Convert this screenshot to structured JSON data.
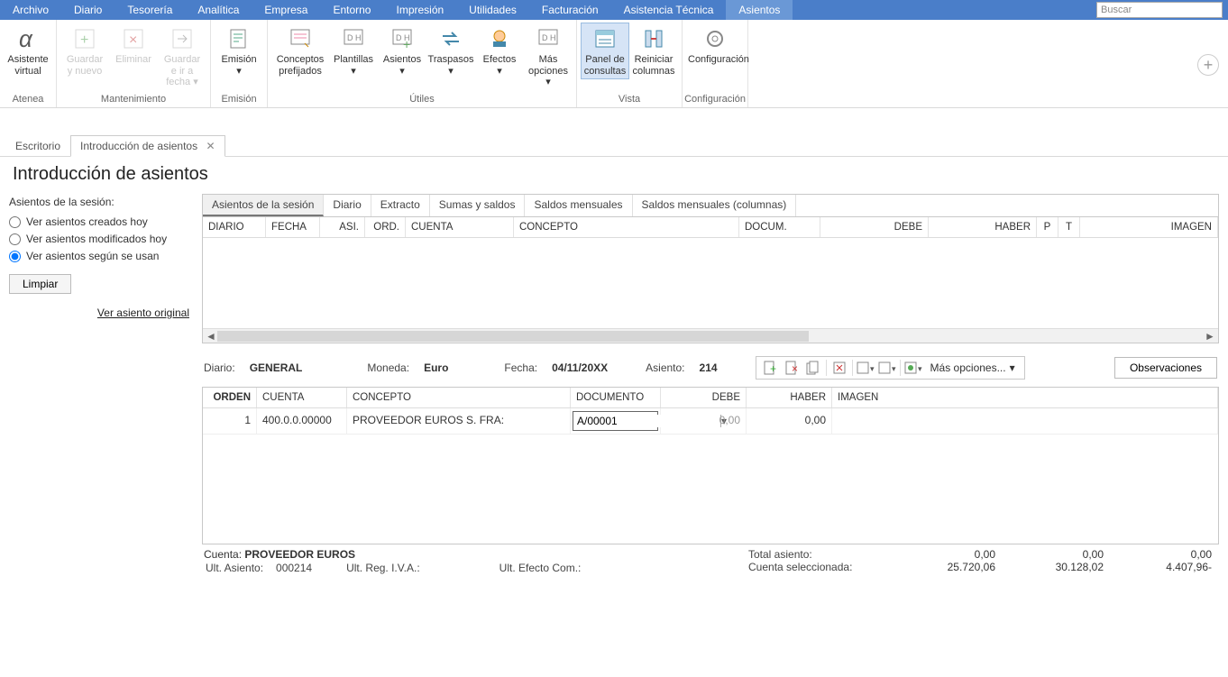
{
  "menubar": {
    "items": [
      "Archivo",
      "Diario",
      "Tesorería",
      "Analítica",
      "Empresa",
      "Entorno",
      "Impresión",
      "Utilidades",
      "Facturación",
      "Asistencia Técnica",
      "Asientos"
    ],
    "active_index": 10,
    "search_placeholder": "Buscar"
  },
  "ribbon": {
    "groups": [
      {
        "label": "Atenea",
        "buttons": [
          {
            "label": "Asistente virtual",
            "icon": "alpha"
          }
        ]
      },
      {
        "label": "Mantenimiento",
        "buttons": [
          {
            "label": "Guardar y nuevo",
            "icon": "save-new",
            "disabled": true
          },
          {
            "label": "Eliminar",
            "icon": "delete",
            "disabled": true
          },
          {
            "label": "Guardar e ir a fecha",
            "icon": "save-goto",
            "disabled": true,
            "dropdown": true
          }
        ]
      },
      {
        "label": "Emisión",
        "buttons": [
          {
            "label": "Emisión",
            "icon": "emit",
            "dropdown": true
          }
        ]
      },
      {
        "label": "Útiles",
        "buttons": [
          {
            "label": "Conceptos prefijados",
            "icon": "concepts"
          },
          {
            "label": "Plantillas",
            "icon": "templates",
            "dropdown": true
          },
          {
            "label": "Asientos",
            "icon": "asientos",
            "dropdown": true
          },
          {
            "label": "Traspasos",
            "icon": "transfers",
            "dropdown": true
          },
          {
            "label": "Efectos",
            "icon": "effects",
            "dropdown": true
          },
          {
            "label": "Más opciones",
            "icon": "more",
            "dropdown": true
          }
        ]
      },
      {
        "label": "Vista",
        "buttons": [
          {
            "label": "Panel de consultas",
            "icon": "panel",
            "active": true
          },
          {
            "label": "Reiniciar columnas",
            "icon": "reset-cols"
          }
        ]
      },
      {
        "label": "Configuración",
        "buttons": [
          {
            "label": "Configuración",
            "icon": "gear"
          }
        ]
      }
    ]
  },
  "workspace_tabs": {
    "items": [
      {
        "label": "Escritorio",
        "closable": false
      },
      {
        "label": "Introducción de asientos",
        "closable": true
      }
    ],
    "active_index": 1
  },
  "page_title": "Introducción de asientos",
  "left_panel": {
    "section": "Asientos de la sesión:",
    "radios": [
      {
        "label": "Ver asientos creados hoy",
        "checked": false
      },
      {
        "label": "Ver asientos modificados hoy",
        "checked": false
      },
      {
        "label": "Ver asientos según se usan",
        "checked": true
      }
    ],
    "clear_btn": "Limpiar",
    "link": "Ver asiento original"
  },
  "consult": {
    "tabs": [
      "Asientos de la sesión",
      "Diario",
      "Extracto",
      "Sumas y saldos",
      "Saldos mensuales",
      "Saldos mensuales (columnas)"
    ],
    "active_tab": 0,
    "columns": [
      "DIARIO",
      "FECHA",
      "ASI.",
      "ORD.",
      "CUENTA",
      "CONCEPTO",
      "DOCUM.",
      "DEBE",
      "HABER",
      "P",
      "T",
      "IMAGEN"
    ]
  },
  "meta": {
    "diario_lbl": "Diario:",
    "diario_val": "GENERAL",
    "moneda_lbl": "Moneda:",
    "moneda_val": "Euro",
    "fecha_lbl": "Fecha:",
    "fecha_val": "04/11/20XX",
    "asiento_lbl": "Asiento:",
    "asiento_val": "214",
    "more_options": "Más opciones...",
    "observaciones": "Observaciones"
  },
  "entry": {
    "columns": [
      "ORDEN",
      "CUENTA",
      "CONCEPTO",
      "DOCUMENTO",
      "DEBE",
      "HABER",
      "IMAGEN"
    ],
    "row": {
      "orden": "1",
      "cuenta": "400.0.0.00000",
      "concepto": "PROVEEDOR EUROS S. FRA:",
      "documento": "A/00001",
      "debe": "0,00",
      "haber": "0,00"
    }
  },
  "footer": {
    "cuenta_lbl": "Cuenta:",
    "cuenta_val": "PROVEEDOR EUROS",
    "ult_asiento_lbl": "Ult. Asiento:",
    "ult_asiento_val": "000214",
    "ult_reg_iva_lbl": "Ult. Reg. I.V.A.:",
    "ult_efecto_lbl": "Ult. Efecto Com.:",
    "total_asiento_lbl": "Total asiento:",
    "cuenta_sel_lbl": "Cuenta seleccionada:",
    "vals_row1": [
      "0,00",
      "0,00",
      "0,00"
    ],
    "vals_row2": [
      "25.720,06",
      "30.128,02",
      "4.407,96-"
    ]
  }
}
